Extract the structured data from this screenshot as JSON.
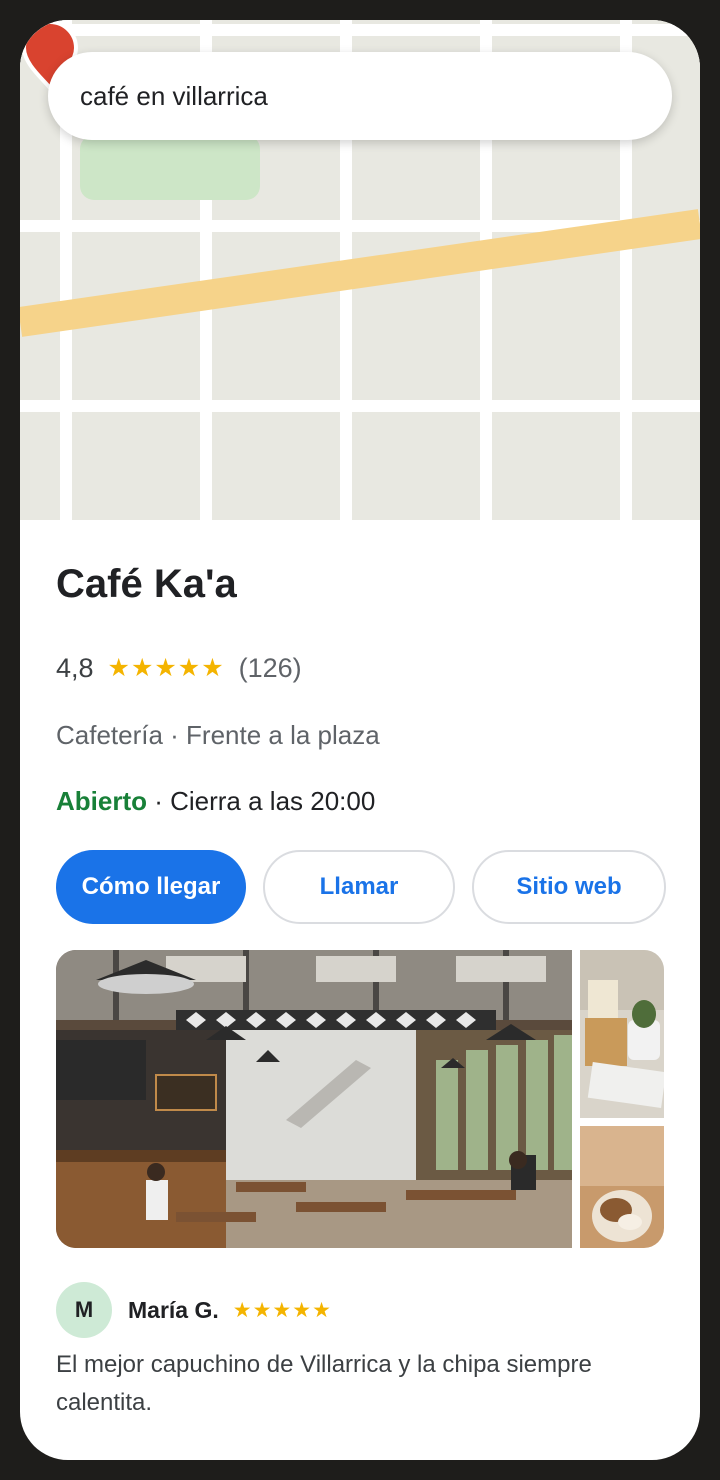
{
  "search": {
    "query": "café en villarrica"
  },
  "place": {
    "name": "Café Ka'a",
    "rating": "4,8",
    "rating_value": 4.8,
    "stars": "★★★★★",
    "reviews_count": "(126)",
    "category_line": "Cafetería · Frente a la plaza",
    "status_open": "Abierto",
    "status_rest": " · Cierra a las 20:00"
  },
  "actions": {
    "directions": "Cómo llegar",
    "call": "Llamar",
    "website": "Sitio web"
  },
  "review": {
    "initial": "M",
    "author": "María G.",
    "stars": "★★★★★",
    "text": "El mejor capuchino de Villarrica y la chipa siempre calentita."
  },
  "colors": {
    "accent": "#1a73e8",
    "open": "#188038",
    "star": "#f4b400",
    "pin": "#d9432f",
    "road": "#f6d38a",
    "park": "#cde6c7",
    "map_bg": "#e8e8e1"
  },
  "icons": {
    "pin": "map-pin-icon"
  }
}
